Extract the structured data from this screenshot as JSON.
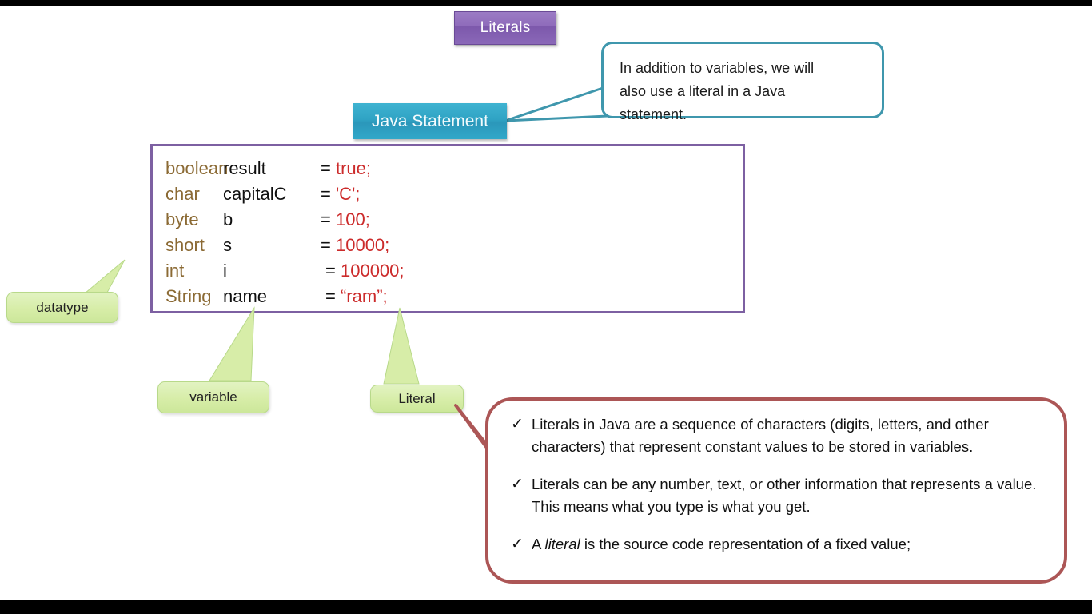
{
  "slide": {
    "title": "Literals",
    "background_color": "#ffffff",
    "letterbox_color": "#000000"
  },
  "title_chip": {
    "label": "Literals",
    "color": "#8a68b8"
  },
  "java_chip": {
    "label": "Java Statement",
    "color": "#2fa3c4"
  },
  "teal_bubble": {
    "border_color": "#3f97ad",
    "lines": [
      "In addition to variables, we will",
      "also use a literal in a Java",
      "statement."
    ]
  },
  "code_block": {
    "border_color": "#7d60a2",
    "type_color": "#8b6a34",
    "variable_color": "#101010",
    "literal_color": "#cc2b2b",
    "rows": [
      {
        "type": "boolean",
        "variable": "result",
        "eq": "=",
        "literal": "true;"
      },
      {
        "type": "char",
        "variable": "capitalC",
        "eq": "=",
        "literal": "'C';"
      },
      {
        "type": "byte",
        "variable": "b",
        "eq": "=",
        "literal": "100;"
      },
      {
        "type": "short",
        "variable": "s",
        "eq": "=",
        "literal": "10000;"
      },
      {
        "type": "int",
        "variable": "i",
        "eq": "=",
        "literal": "100000;"
      },
      {
        "type": "String",
        "variable": "name",
        "eq": "=",
        "literal": "“ram”;"
      }
    ]
  },
  "green_labels": {
    "color": "#d7eda8",
    "datatype": "datatype",
    "variable": "variable",
    "literal": "Literal"
  },
  "red_bubble": {
    "border_color": "#ac5656",
    "bullet_icon": "✓",
    "bullets": [
      {
        "pre": "Literals in Java are a sequence of characters (digits, letters, and other characters) that represent constant values to be stored in variables.",
        "em": "",
        "post": ""
      },
      {
        "pre": "Literals can be any number, text, or other information that represents a value. This means what you type is what you get.",
        "em": "",
        "post": ""
      },
      {
        "pre": " A ",
        "em": "literal",
        "post": " is the source code representation of a fixed value;"
      }
    ]
  }
}
